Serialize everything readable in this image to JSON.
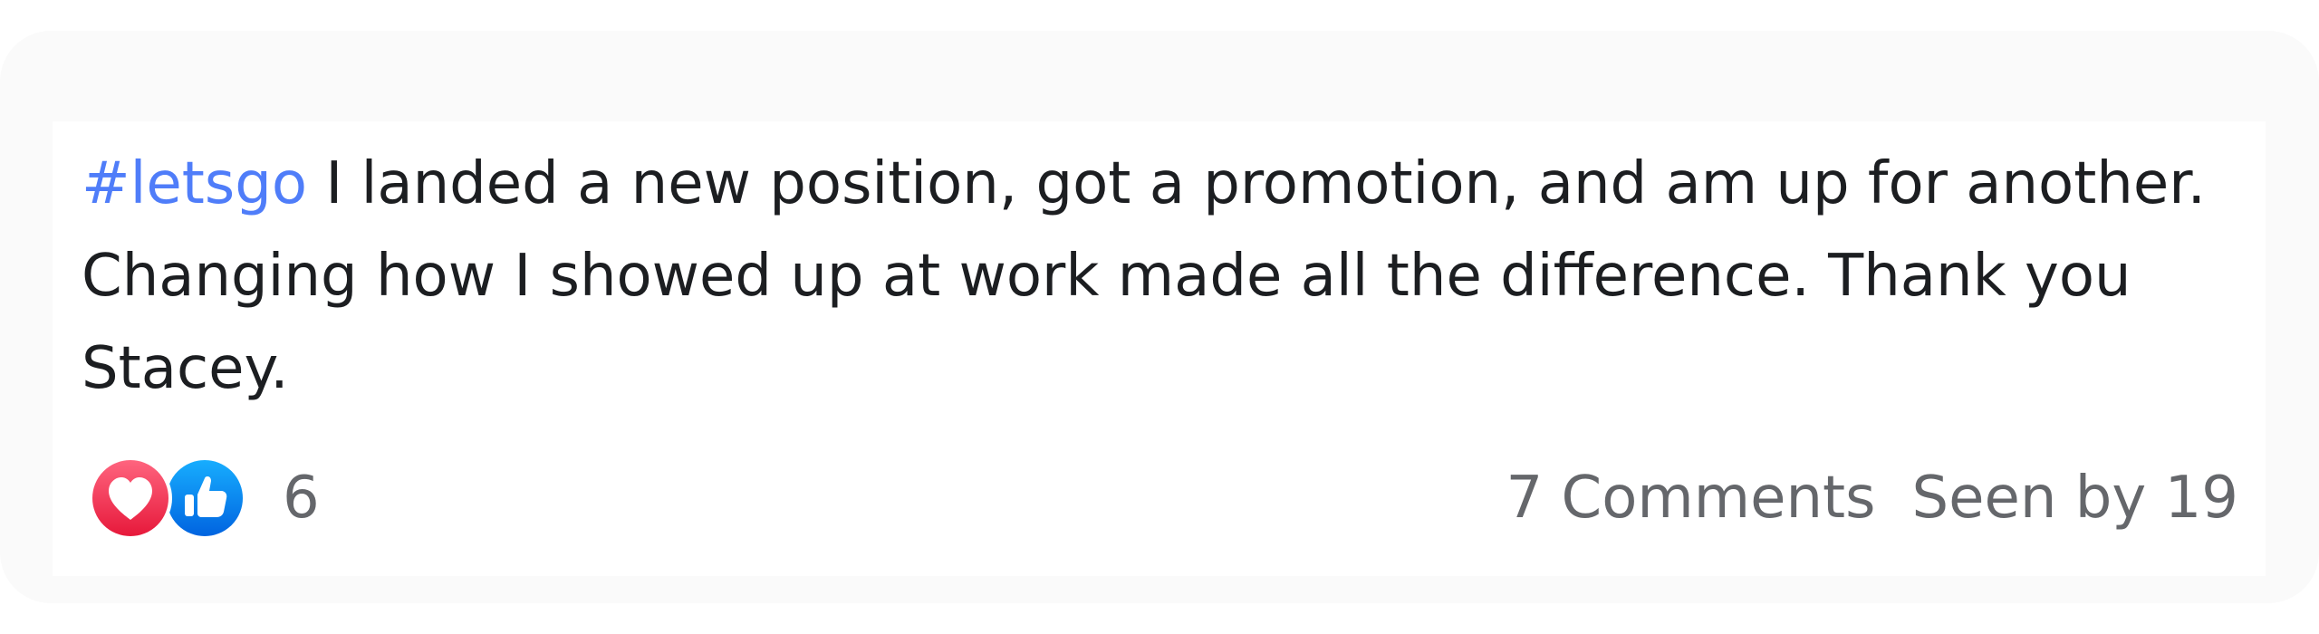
{
  "post": {
    "hashtag": "#letsgo",
    "body": " I landed a new position, got a promotion, and am up for another. Changing how I showed up at work made all the difference. Thank you Stacey."
  },
  "reactions": {
    "icons": [
      "heart-icon",
      "thumbs-up-icon"
    ],
    "love_color": "#f33e58",
    "like_color": "#1877f2",
    "count": "6"
  },
  "stats": {
    "comments": "7 Comments",
    "seen_by": "Seen by 19"
  },
  "colors": {
    "hashtag": "#4f7df9",
    "text": "#1c1e21",
    "muted": "#65676b"
  }
}
